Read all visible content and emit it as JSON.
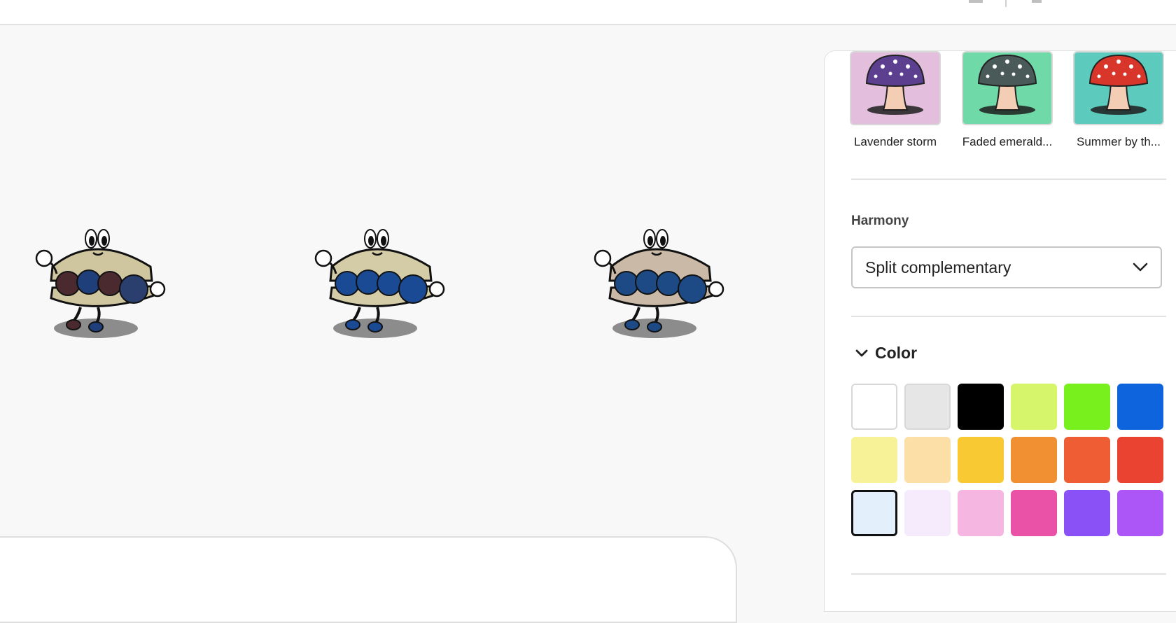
{
  "canvas": {
    "variants": [
      {
        "name": "variant-1",
        "fill": [
          "#4a2a2e",
          "#1f3f7a",
          "#4a2a2e",
          "#2a3f6e"
        ],
        "bun": "#cfc6a0"
      },
      {
        "name": "variant-2",
        "fill": [
          "#1b4a95",
          "#1b4a95",
          "#1b4a95",
          "#1b4a95"
        ],
        "bun": "#d3cca6"
      },
      {
        "name": "variant-3",
        "fill": [
          "#1d4a85",
          "#1d4a85",
          "#1d4a85",
          "#1d4a85"
        ],
        "bun": "#c9b9a6"
      }
    ]
  },
  "panel": {
    "styles": [
      {
        "label": "Lavender storm",
        "bg": "#e4bfdd",
        "cap": "#5c3f8f"
      },
      {
        "label": "Faded emerald...",
        "bg": "#6fdaa8",
        "cap": "#4a5a58"
      },
      {
        "label": "Summer by th...",
        "bg": "#5ccbbe",
        "cap": "#d9362b"
      }
    ],
    "harmony": {
      "label": "Harmony",
      "value": "Split complementary"
    },
    "color": {
      "label": "Color",
      "swatches": [
        {
          "color": "#ffffff",
          "name": "swatch-white"
        },
        {
          "color": "#e6e6e6",
          "name": "swatch-light-gray"
        },
        {
          "color": "#000000",
          "name": "swatch-black"
        },
        {
          "color": "#d7f56a",
          "name": "swatch-lime"
        },
        {
          "color": "#77f01d",
          "name": "swatch-green"
        },
        {
          "color": "#0e64dc",
          "name": "swatch-blue"
        },
        {
          "color": "#f7f298",
          "name": "swatch-light-yellow"
        },
        {
          "color": "#fcdfa7",
          "name": "swatch-peach"
        },
        {
          "color": "#f9c933",
          "name": "swatch-yellow"
        },
        {
          "color": "#f19032",
          "name": "swatch-orange"
        },
        {
          "color": "#ef5d34",
          "name": "swatch-red-orange"
        },
        {
          "color": "#ea4331",
          "name": "swatch-red"
        },
        {
          "color": "#e3f0fb",
          "name": "swatch-ice-blue"
        },
        {
          "color": "#f6ebfc",
          "name": "swatch-lavender-white"
        },
        {
          "color": "#f5b7e1",
          "name": "swatch-pink"
        },
        {
          "color": "#ea52a8",
          "name": "swatch-magenta"
        },
        {
          "color": "#8a52f6",
          "name": "swatch-violet"
        },
        {
          "color": "#ad56f7",
          "name": "swatch-purple"
        }
      ],
      "selected_index": 12
    }
  }
}
